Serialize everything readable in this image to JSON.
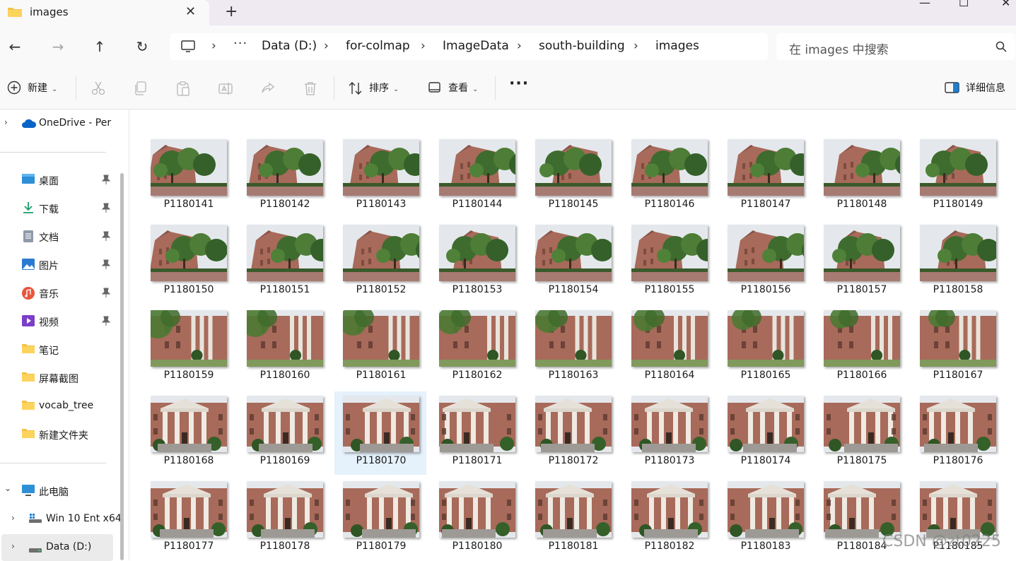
{
  "tab": {
    "title": "images",
    "close": "✕",
    "add": "+"
  },
  "window": {
    "minimize": "—",
    "maximize": "☐",
    "close": "✕"
  },
  "nav": {
    "back": "←",
    "forward": "→",
    "up": "↑",
    "refresh": "↻"
  },
  "address": {
    "sep": "›",
    "more": "···",
    "crumbs": [
      "Data (D:)",
      "for-colmap",
      "ImageData",
      "south-building",
      "images"
    ]
  },
  "search": {
    "placeholder": "在 images 中搜索"
  },
  "commands": {
    "new": "新建",
    "sort": "排序",
    "view": "查看",
    "more": "···",
    "details": "详细信息",
    "caret": "⌄"
  },
  "sidebar": {
    "chevron_right": "›",
    "chevron_down": "⌄",
    "pin": "📌",
    "onedrive": "OneDrive - Per",
    "quick": [
      "桌面",
      "下载",
      "文档",
      "图片",
      "音乐",
      "视频",
      "笔记",
      "屏幕截图",
      "vocab_tree",
      "新建文件夹"
    ],
    "thispc": "此电脑",
    "drives": [
      "Win 10 Ent x64",
      "Data (D:)"
    ]
  },
  "files": [
    "P1180141",
    "P1180142",
    "P1180143",
    "P1180144",
    "P1180145",
    "P1180146",
    "P1180147",
    "P1180148",
    "P1180149",
    "P1180150",
    "P1180151",
    "P1180152",
    "P1180153",
    "P1180154",
    "P1180155",
    "P1180156",
    "P1180157",
    "P1180158",
    "P1180159",
    "P1180160",
    "P1180161",
    "P1180162",
    "P1180163",
    "P1180164",
    "P1180165",
    "P1180166",
    "P1180167",
    "P1180168",
    "P1180169",
    "P1180170",
    "P1180171",
    "P1180172",
    "P1180173",
    "P1180174",
    "P1180175",
    "P1180176",
    "P1180177",
    "P1180178",
    "P1180179",
    "P1180180",
    "P1180181",
    "P1180182",
    "P1180183",
    "P1180184",
    "P1180185"
  ],
  "selected_file": "P1180170",
  "watermark": "CSDN @zt0225",
  "colors": {
    "accent": "#0067c0",
    "selection": "#e5f1fb",
    "brick": "#a86a5a",
    "foliage": "#3e6b2e",
    "sky": "#e4e8ec"
  }
}
